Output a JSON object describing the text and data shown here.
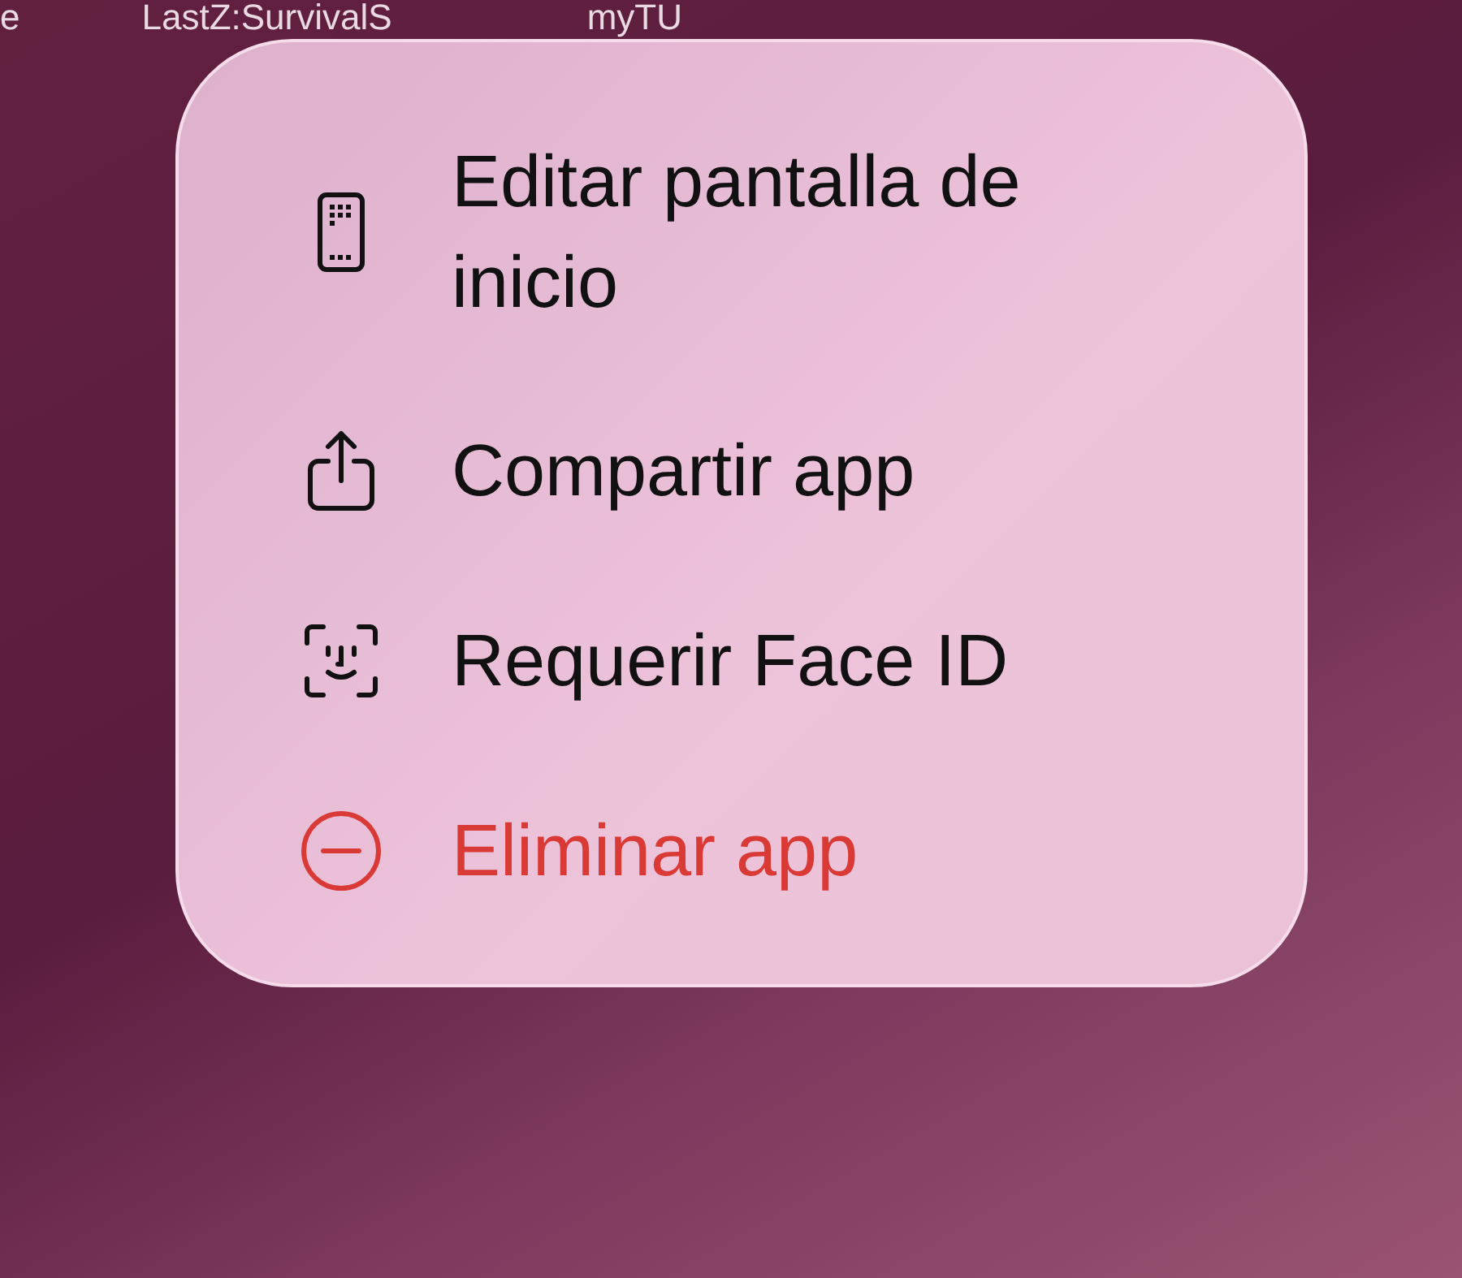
{
  "home_labels": [
    "e",
    "LastZ:SurvivalS",
    "myTU"
  ],
  "menu": {
    "items": [
      {
        "kind": "edit",
        "label": "Editar pantalla de inicio"
      },
      {
        "kind": "share",
        "label": "Compartir app"
      },
      {
        "kind": "faceid",
        "label": "Requerir Face ID"
      },
      {
        "kind": "delete",
        "label": "Eliminar app"
      }
    ]
  }
}
